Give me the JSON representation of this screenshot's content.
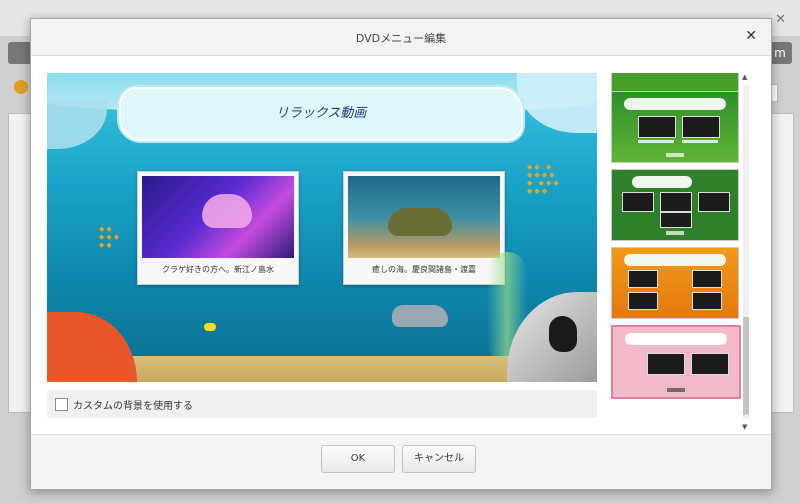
{
  "dialog": {
    "title": "DVDメニュー編集",
    "close_glyph": "✕"
  },
  "preview": {
    "menu_title": "リラックス動画",
    "videos": [
      {
        "caption": "クラゲ好きの方へ。新江ノ島水"
      },
      {
        "caption": "癒しの海。慶良間諸島・渡嘉"
      }
    ]
  },
  "custom_background": {
    "label": "カスタムの背景を使用する",
    "checked": false
  },
  "templates": {
    "count_visible": 5,
    "selected_index": 4
  },
  "buttons": {
    "ok": "OK",
    "cancel": "キャンセル"
  },
  "background_app": {
    "close_glyph": "✕",
    "right_button_text": "m"
  }
}
